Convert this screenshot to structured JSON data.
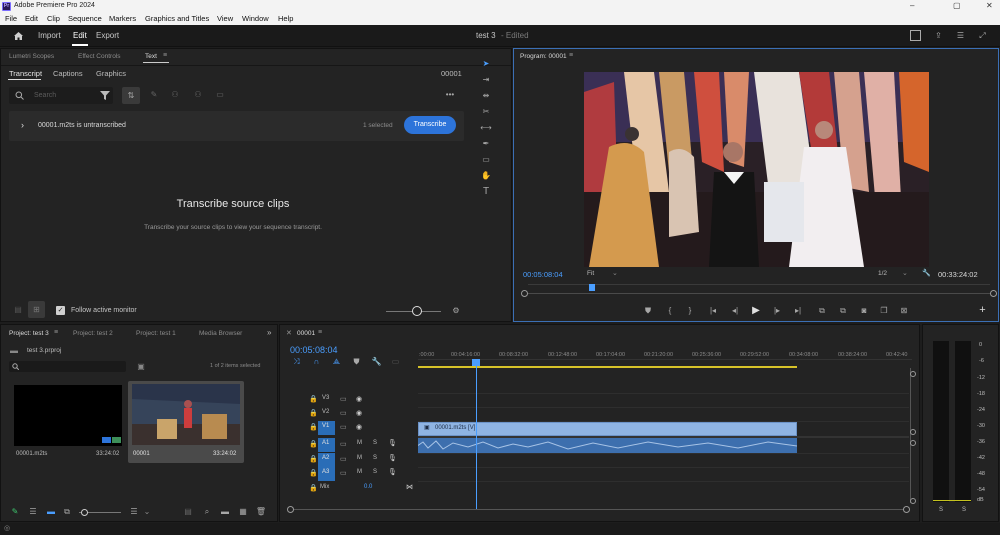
{
  "window": {
    "title": "Adobe Premiere Pro 2024",
    "app_icon": "Pr",
    "controls": [
      "–",
      "▢",
      "✕"
    ]
  },
  "menu": [
    "File",
    "Edit",
    "Clip",
    "Sequence",
    "Markers",
    "Graphics and Titles",
    "View",
    "Window",
    "Help"
  ],
  "workspace": {
    "tabs": [
      "Import",
      "Edit",
      "Export"
    ],
    "active": "Edit",
    "project_name": "test 3",
    "status": "- Edited"
  },
  "text_panel": {
    "tabs": [
      "Lumetri Scopes",
      "Effect Controls",
      "Text"
    ],
    "subtabs": [
      "Transcript",
      "Captions",
      "Graphics"
    ],
    "sequence_tc": "00001",
    "search_placeholder": "Search",
    "clip_name": "00001.m2ts is untranscribed",
    "selected_label": "1 selected",
    "transcribe_button": "Transcribe",
    "heading": "Transcribe source clips",
    "subheading": "Transcribe your source clips to view your sequence transcript.",
    "follow_label": "Follow active monitor"
  },
  "program": {
    "tab": "Program: 00001",
    "timecode": "00:05:08:04",
    "fit": "Fit",
    "resolution": "1/2",
    "duration": "00:33:24:02"
  },
  "project": {
    "tabs": [
      "Project: test 3",
      "Project: test 2",
      "Project: test 1",
      "Media Browser"
    ],
    "file": "test 3.prproj",
    "items_selected": "1 of 2 items selected",
    "items": [
      {
        "name": "00001.m2ts",
        "duration": "33:24:02"
      },
      {
        "name": "00001",
        "duration": "33:24:02"
      }
    ]
  },
  "timeline": {
    "tab": "00001",
    "timecode": "00:05:08:04",
    "ruler": [
      ":00:00",
      "00:04:16:00",
      "00:08:32:00",
      "00:12:48:00",
      "00:17:04:00",
      "00:21:20:00",
      "00:25:36:00",
      "00:29:52:00",
      "00:34:08:00",
      "00:38:24:00",
      "00:42:40"
    ],
    "tracks": [
      "V3",
      "V2",
      "V1",
      "A1",
      "A2",
      "A3"
    ],
    "mix_label": "Mix",
    "mix_value": "0.0",
    "clip_label": "00001.m2ts [V]"
  },
  "meter": {
    "scale": [
      "0",
      "-6",
      "-12",
      "-18",
      "-24",
      "-30",
      "-36",
      "-42",
      "-48",
      "-54",
      "dB"
    ],
    "solo": [
      "S",
      "S"
    ]
  },
  "colors": {
    "accent": "#2d74da",
    "playhead": "#4a9eff",
    "clip": "#8fb4e3",
    "audio": "#3d6fae",
    "track_target": "#2a6db7"
  }
}
